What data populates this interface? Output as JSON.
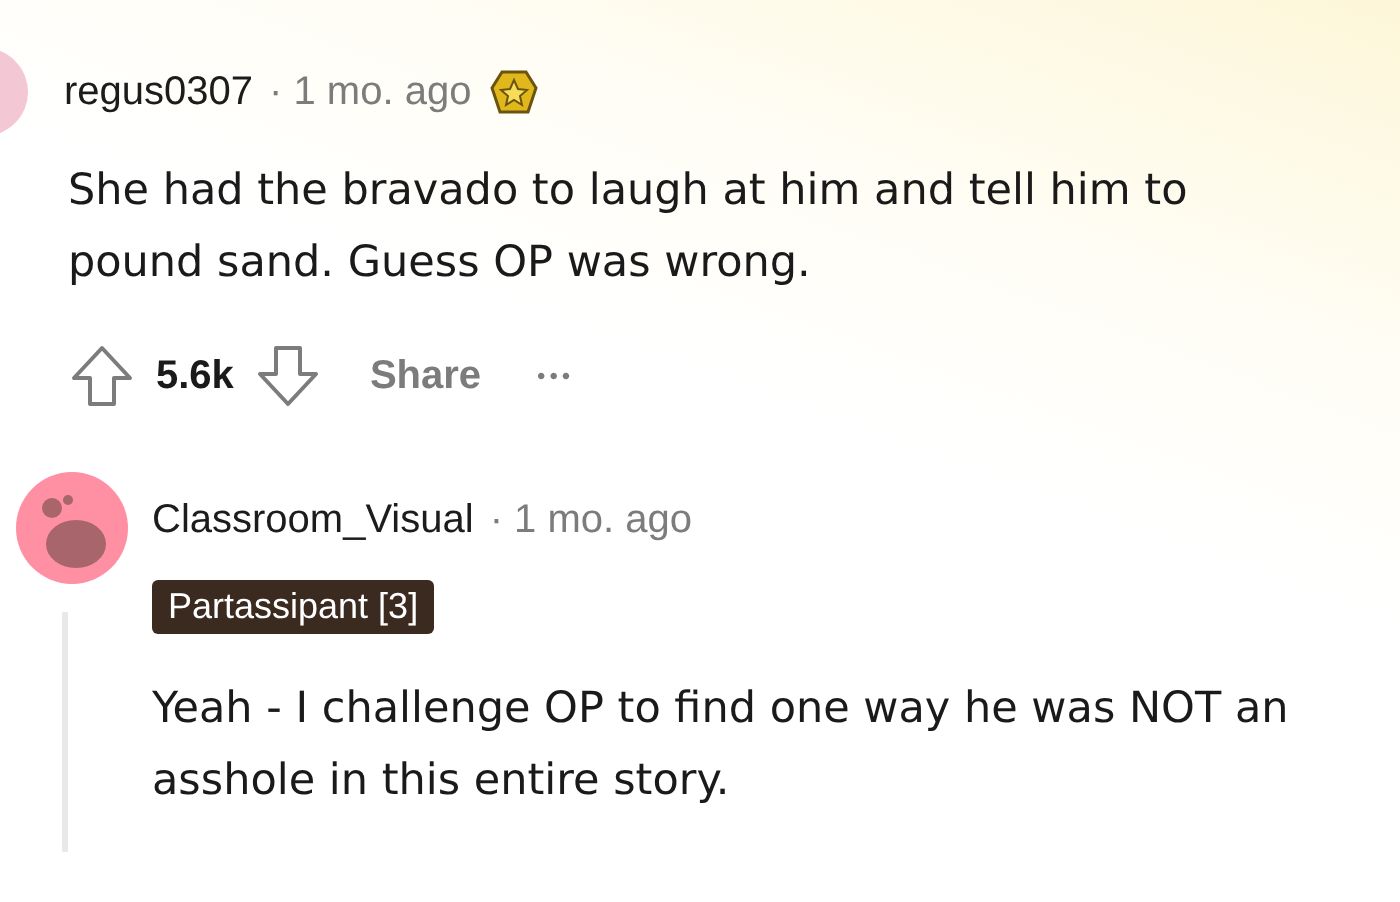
{
  "comments": [
    {
      "username": "regus0307",
      "time": "· 1 mo. ago",
      "award": true,
      "body": "She had the bravado to laugh at him and tell him to pound sand. Guess OP was wrong.",
      "votes": "5.6k",
      "share": "Share",
      "more": "•••"
    },
    {
      "username": "Classroom_Visual",
      "time": "· 1 mo. ago",
      "flair": "Partassipant [3]",
      "body": "Yeah - I challenge OP to find one way he was NOT an asshole in this entire story."
    }
  ]
}
